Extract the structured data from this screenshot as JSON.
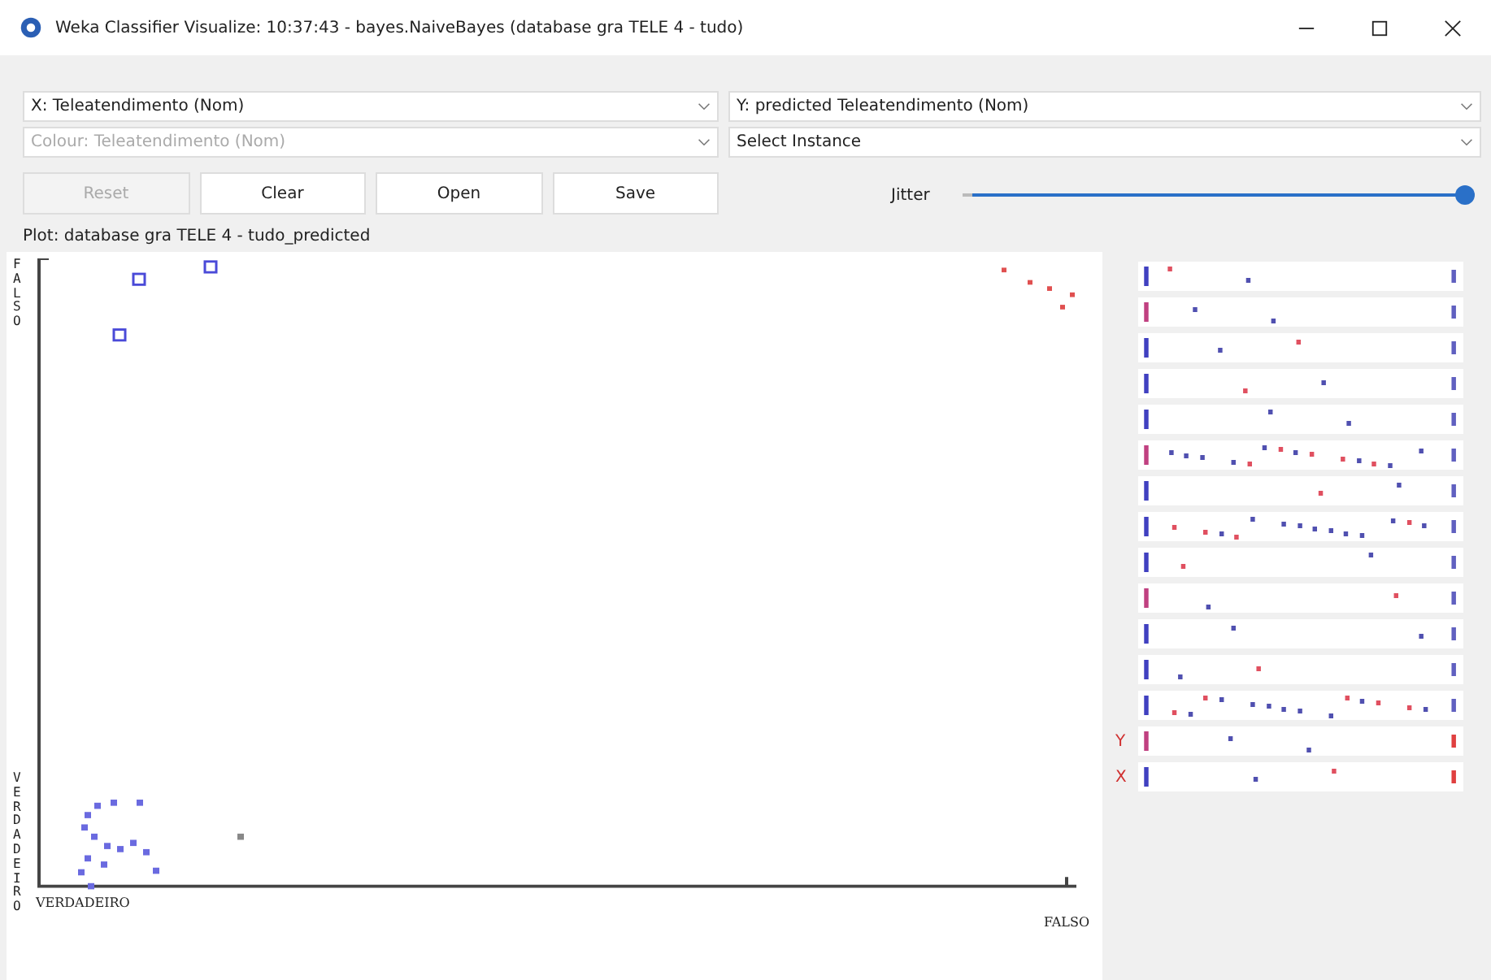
{
  "window": {
    "title": "Weka Classifier Visualize: 10:37:43 - bayes.NaiveBayes (database gra TELE 4 - tudo)"
  },
  "selectors": [
    {
      "value": "X: Teleatendimento (Nom)",
      "disabled": false
    },
    {
      "value": "Y: predicted Teleatendimento (Nom)",
      "disabled": false
    },
    {
      "value": "Colour: Teleatendimento (Nom)",
      "disabled": true
    },
    {
      "value": "Select Instance",
      "disabled": false
    }
  ],
  "buttons": [
    {
      "label": "Reset",
      "disabled": true
    },
    {
      "label": "Clear",
      "disabled": false
    },
    {
      "label": "Open",
      "disabled": false
    },
    {
      "label": "Save",
      "disabled": false
    }
  ],
  "jitter": {
    "label": "Jitter",
    "level": 1.0
  },
  "plot": {
    "title": "Plot: database gra TELE 4 - tudo_predicted",
    "y_top": "FALSO",
    "y_bottom": "VERDADEIRO",
    "x_left": "VERDADEIRO",
    "x_right": "FALSO"
  },
  "attribute_panel": {
    "y_marker": "Y",
    "x_marker": "X"
  }
}
